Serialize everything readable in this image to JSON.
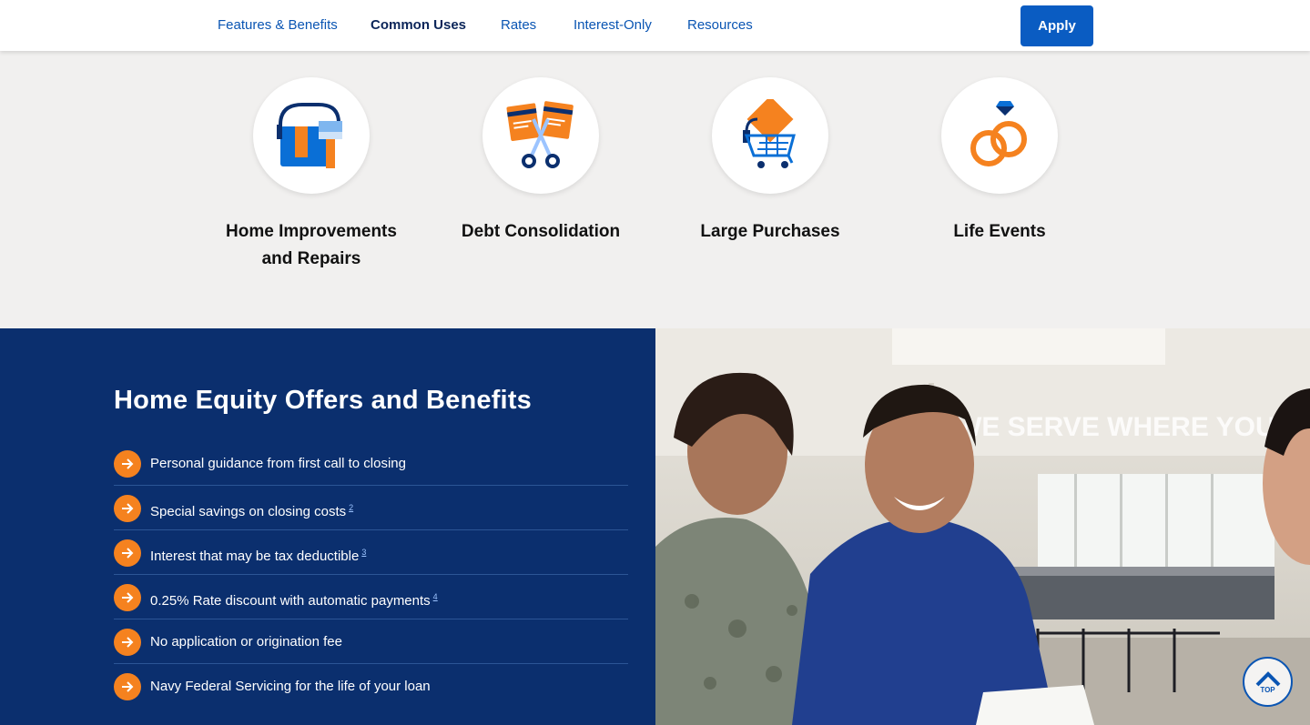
{
  "nav": {
    "links": [
      "Features & Benefits",
      "Common Uses",
      "Rates",
      "Interest-Only",
      "Resources"
    ],
    "active": "Common Uses",
    "apply_label": "Apply"
  },
  "uses": [
    {
      "label_line1": "Home Improvements",
      "label_line2": "and Repairs",
      "icon": "paint-bucket-icon"
    },
    {
      "label_line1": "Debt Consolidation",
      "label_line2": "",
      "icon": "cut-cards-icon"
    },
    {
      "label_line1": "Large Purchases",
      "label_line2": "",
      "icon": "shopping-cart-icon"
    },
    {
      "label_line1": "Life Events",
      "label_line2": "",
      "icon": "wedding-rings-icon"
    }
  ],
  "offers": {
    "title": "Home Equity Offers and Benefits",
    "benefits": [
      {
        "text": "Personal guidance from first call to closing",
        "footnote": ""
      },
      {
        "text": "Special savings on closing costs",
        "footnote": "2"
      },
      {
        "text": "Interest that may be tax deductible",
        "footnote": "3"
      },
      {
        "text": "0.25% Rate discount with automatic payments",
        "footnote": "4"
      },
      {
        "text": "No application or origination fee",
        "footnote": ""
      },
      {
        "text": "Navy Federal Servicing for the life of your loan",
        "footnote": ""
      }
    ]
  },
  "photo": {
    "wall_text": "WE SERVE WHERE YOU SERVE"
  },
  "top_button": {
    "label": "TOP"
  },
  "colors": {
    "navy": "#0b2f6e",
    "blue": "#0a5cc2",
    "orange": "#f5821f",
    "light_bg": "#f1f0ef"
  }
}
